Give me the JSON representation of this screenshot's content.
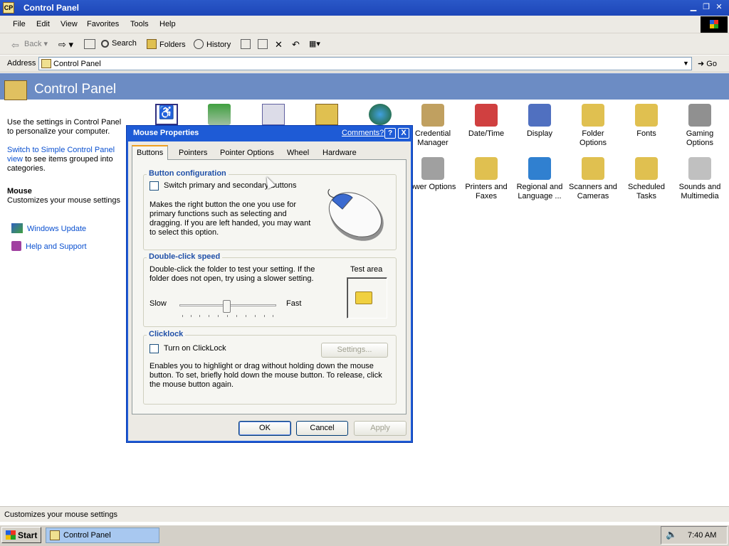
{
  "window": {
    "title": "Control Panel"
  },
  "menu": [
    "File",
    "Edit",
    "View",
    "Favorites",
    "Tools",
    "Help"
  ],
  "toolbar": {
    "back": "Back",
    "search": "Search",
    "folders": "Folders",
    "history": "History"
  },
  "address": {
    "label": "Address",
    "value": "Control Panel",
    "go": "Go"
  },
  "header": {
    "title": "Control Panel"
  },
  "left_pane": {
    "intro": "Use the settings in Control Panel to personalize your computer.",
    "switch_link": "Switch to Simple Control Panel view",
    "switch_rest": "to see items grouped into categories.",
    "item_title": "Mouse",
    "item_desc": "Customizes your mouse settings",
    "links": [
      "Windows Update",
      "Help and Support"
    ]
  },
  "icons": [
    {
      "label": "Credential Manager",
      "color": "#c0a060"
    },
    {
      "label": "Date/Time",
      "color": "#d04040"
    },
    {
      "label": "Display",
      "color": "#5070c0"
    },
    {
      "label": "Folder Options",
      "color": "#e0c050"
    },
    {
      "label": "Fonts",
      "color": "#e0c050"
    },
    {
      "label": "Gaming Options",
      "color": "#909090"
    },
    {
      "label": "ower Options",
      "color": "#a0a0a0"
    },
    {
      "label": "Printers and Faxes",
      "color": "#e0c050"
    },
    {
      "label": "Regional and Language ...",
      "color": "#3080d0"
    },
    {
      "label": "Scanners and Cameras",
      "color": "#e0c050"
    },
    {
      "label": "Scheduled Tasks",
      "color": "#e0c050"
    },
    {
      "label": "Sounds and Multimedia",
      "color": "#c0c0c0"
    }
  ],
  "dialog": {
    "title": "Mouse Properties",
    "comments": "Comments?",
    "help": "?",
    "close": "X",
    "tabs": [
      "Buttons",
      "Pointers",
      "Pointer Options",
      "Wheel",
      "Hardware"
    ],
    "active_tab": "Buttons",
    "button_config": {
      "title": "Button configuration",
      "checkbox": "Switch primary and secondary buttons",
      "checked": false,
      "desc": "Makes the right button the one you use for primary functions such as selecting and dragging. If you are left handed, you may want to select this option."
    },
    "double_click": {
      "title": "Double-click speed",
      "desc": "Double-click the folder to test your setting. If the folder does not open, try using a slower setting.",
      "test_area": "Test area",
      "slow": "Slow",
      "fast": "Fast"
    },
    "clicklock": {
      "title": "Clicklock",
      "checkbox": "Turn on ClickLock",
      "checked": false,
      "settings": "Settings...",
      "desc": "Enables you to highlight or drag without holding down the mouse button. To set, briefly hold down the mouse button. To release, click the mouse button again."
    },
    "buttons": {
      "ok": "OK",
      "cancel": "Cancel",
      "apply": "Apply"
    }
  },
  "status": {
    "text": "Customizes your mouse settings"
  },
  "taskbar": {
    "start": "Start",
    "item": "Control Panel",
    "clock": "7:40 AM"
  }
}
